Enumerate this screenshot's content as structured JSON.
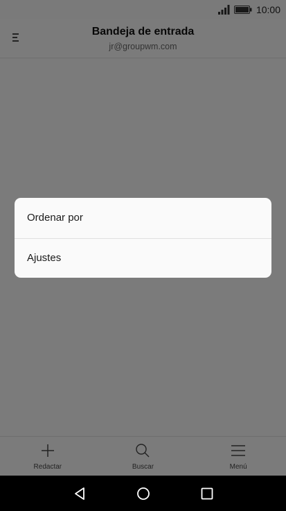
{
  "status_bar": {
    "time": "10:00",
    "icons": [
      "signal-icon",
      "battery-icon"
    ]
  },
  "header": {
    "title": "Bandeja de entrada",
    "subtitle": "jr@groupwm.com",
    "menu_icon": "menu-toggle-icon"
  },
  "bottom_bar": {
    "items": [
      {
        "label": "Redactar",
        "icon": "plus-icon"
      },
      {
        "label": "Buscar",
        "icon": "search-icon"
      },
      {
        "label": "Menú",
        "icon": "hamburger-icon"
      }
    ]
  },
  "dialog": {
    "items": [
      {
        "label": "Ordenar por"
      },
      {
        "label": "Ajustes"
      }
    ]
  },
  "nav_bar": {
    "icons": [
      "back-icon",
      "home-icon",
      "recents-icon"
    ]
  },
  "colors": {
    "overlay": "rgba(0,0,0,0.5)",
    "dialog_bg": "#fafafa",
    "nav_bar": "#000000"
  }
}
